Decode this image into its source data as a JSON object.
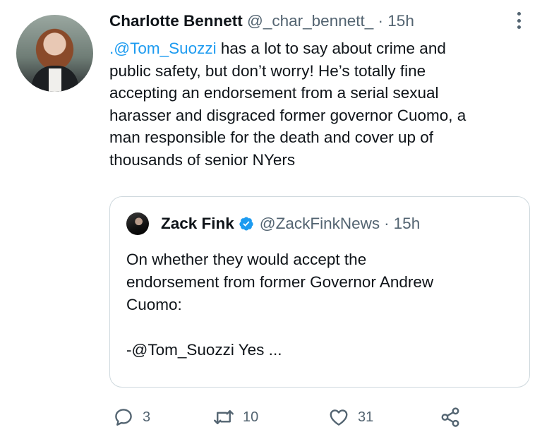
{
  "tweet": {
    "author_name": "Charlotte Bennett",
    "author_handle": "@_char_bennett_",
    "separator": "·",
    "time": "15h",
    "text_lines": [
      {
        "mention": ".@Tom_Suozzi",
        "rest": " has a lot to say about crime and"
      },
      {
        "text": "public safety, but don’t worry! He’s totally fine"
      },
      {
        "text": "accepting an endorsement from a serial sexual"
      },
      {
        "text": "harasser and disgraced former governor Cuomo, a"
      },
      {
        "text": "man responsible for the death and cover up of"
      },
      {
        "text": "thousands of senior NYers"
      }
    ]
  },
  "quoted_tweet": {
    "author_name": "Zack Fink",
    "author_handle": "@ZackFinkNews",
    "separator": "·",
    "time": "15h",
    "text_lines": [
      "On whether they would accept the",
      "endorsement from former Governor Andrew",
      "Cuomo:",
      "",
      "-@Tom_Suozzi Yes ..."
    ]
  },
  "actions": {
    "reply_count": "3",
    "retweet_count": "10",
    "like_count": "31"
  },
  "icons": [
    "more-icon",
    "verified-icon",
    "reply-icon",
    "retweet-icon",
    "like-icon",
    "share-icon"
  ],
  "colors": {
    "text": "#0f1419",
    "secondary": "#536471",
    "link": "#1d9bf0",
    "border": "#cfd9de",
    "verified": "#1d9bf0"
  }
}
